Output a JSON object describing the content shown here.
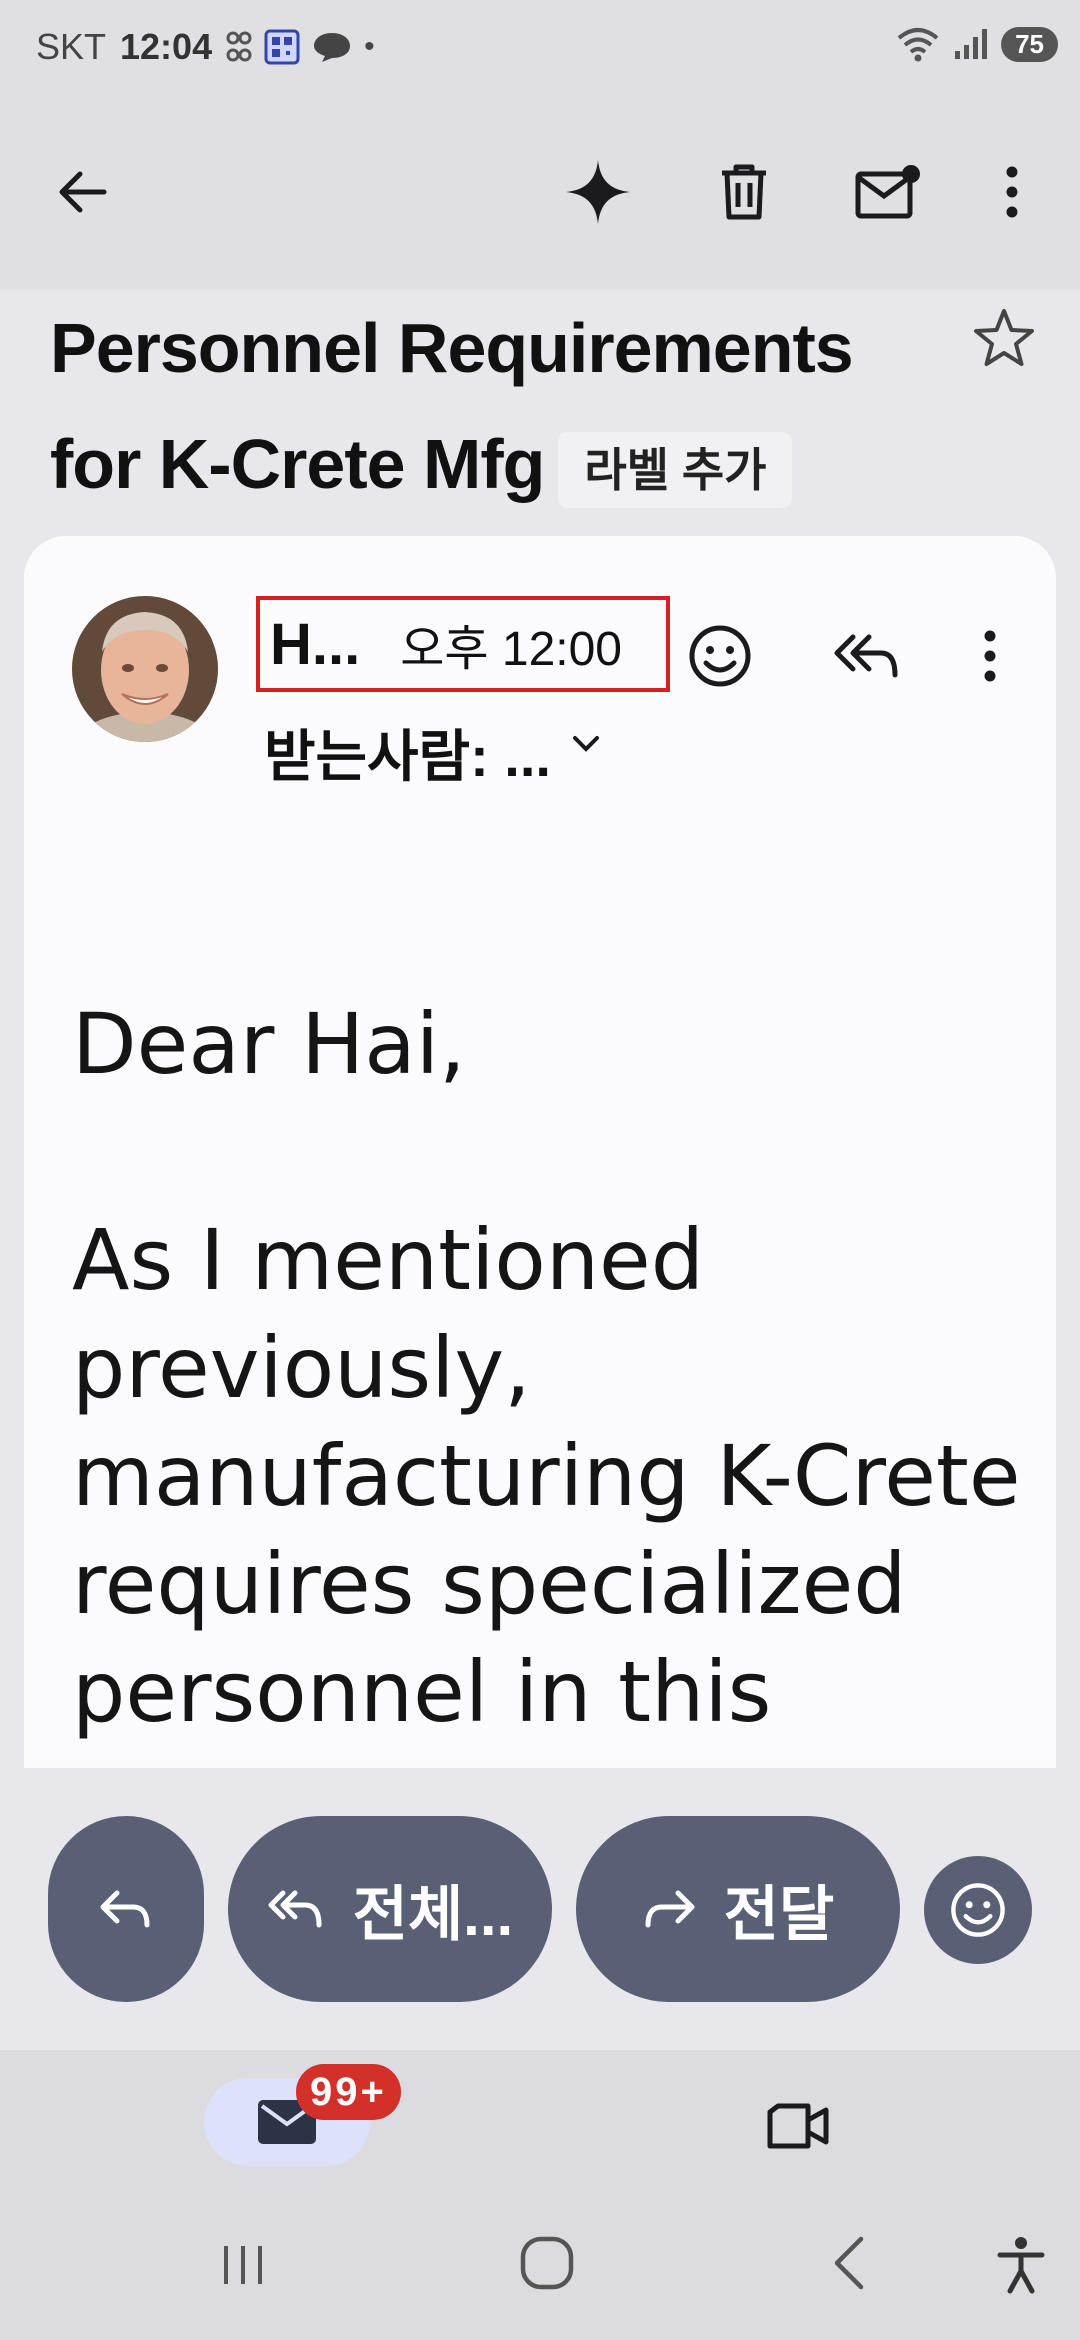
{
  "status_bar": {
    "carrier": "SKT",
    "time": "12:04",
    "battery": "75"
  },
  "app_bar": {
    "back_icon": "arrow-left-icon",
    "gemini_icon": "sparkle-icon",
    "delete_icon": "trash-icon",
    "unread_icon": "mail-unread-icon",
    "more_icon": "more-vert-icon"
  },
  "email": {
    "subject": "Personnel Requirements for K-Crete Mfg",
    "label_chip": "라벨 추가",
    "sender_name": "H...",
    "time": "오후 12:00",
    "recipient": "받는사람: ...",
    "greeting": "Dear Hai,",
    "body": "As I mentioned previously, manufacturing K-Crete requires specialized personnel in this"
  },
  "actions": {
    "reply_all": "전체...",
    "forward": "전달"
  },
  "bottom_nav": {
    "mail_badge": "99+"
  },
  "colors": {
    "accent": "#596075",
    "badge": "#d3302a",
    "highlight": "#d32020"
  }
}
